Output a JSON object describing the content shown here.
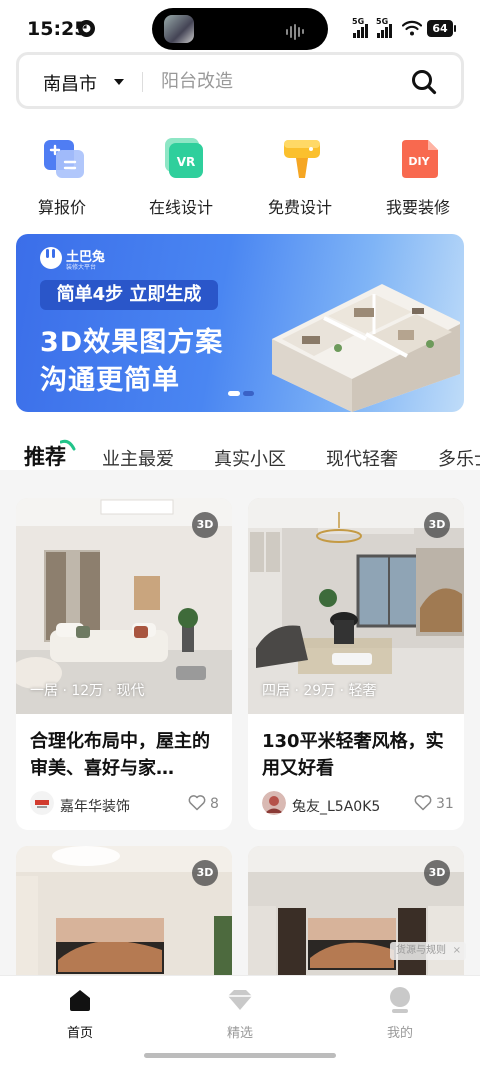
{
  "status_bar": {
    "time": "15:25",
    "app_icon_glyph": "◕",
    "network_1": "5G",
    "network_2": "5G",
    "battery": "64"
  },
  "search": {
    "city": "南昌市",
    "placeholder": "阳台改造"
  },
  "quick_actions": [
    {
      "label": "算报价",
      "icon": "calculator-icon",
      "color": "#4f7df3"
    },
    {
      "label": "在线设计",
      "icon": "vr-icon",
      "icon_text": "VR",
      "color": "#2fcf9c"
    },
    {
      "label": "免费设计",
      "icon": "brush-icon",
      "color": "#fbc02d"
    },
    {
      "label": "我要装修",
      "icon": "diy-icon",
      "icon_text": "DIY",
      "color": "#f8694f"
    }
  ],
  "banner": {
    "brand": "土巴兔",
    "brand_sub": "装修大平台",
    "tag": "简单4步 立即生成",
    "line1": "3D效果图方案",
    "line2": "沟通更简单"
  },
  "tabs": [
    {
      "label": "推荐",
      "active": true
    },
    {
      "label": "业主最爱"
    },
    {
      "label": "真实小区"
    },
    {
      "label": "现代轻奢"
    },
    {
      "label": "多乐士"
    }
  ],
  "feed": [
    {
      "badge": "3D",
      "meta": "一居 · 12万 · 现代",
      "title": "合理化布局中，屋主的审美、喜好与家…",
      "author": "嘉年华装饰",
      "likes": "8"
    },
    {
      "badge": "3D",
      "meta": "四居 · 29万 · 轻奢",
      "title": "130平米轻奢风格，实用又好看",
      "author": "兔友_L5A0K5",
      "likes": "31"
    },
    {
      "badge": "3D"
    },
    {
      "badge": "3D"
    }
  ],
  "ad_chip": {
    "text": "货源与规则",
    "close": "×"
  },
  "bottom_nav": [
    {
      "label": "首页",
      "icon": "home-icon",
      "active": true
    },
    {
      "label": "精选",
      "icon": "diamond-icon"
    },
    {
      "label": "我的",
      "icon": "profile-icon"
    }
  ],
  "colors": {
    "accent_green": "#22c48a",
    "banner_blue": "#3b6ee9",
    "nav_active": "#111111",
    "nav_inactive": "#9a9a9a"
  }
}
